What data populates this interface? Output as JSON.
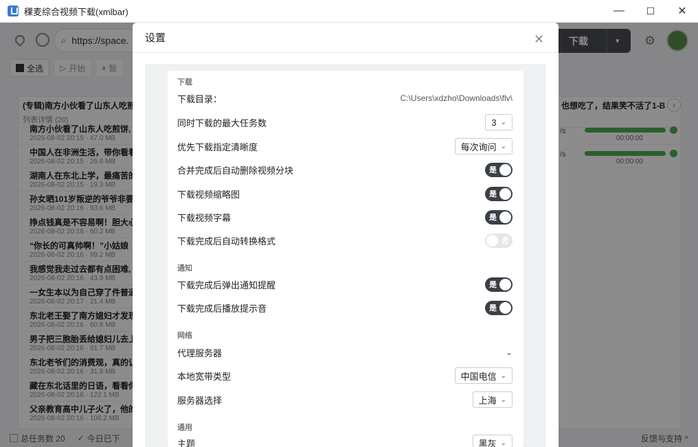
{
  "window": {
    "title": "稞麦综合视频下载(xmlbar)",
    "minimize": "—",
    "maximize": "☐",
    "close": "✕"
  },
  "toolbar": {
    "url": "https://space.",
    "download_label": "下载",
    "dropdown": "▾"
  },
  "actions": {
    "select_all": "全选",
    "start": "开始",
    "pause": "暂"
  },
  "list": {
    "group_title": "(专辑)南方小伙看了山东人吃煎",
    "group_sub": "列表详情 (20)",
    "right_title": "也想吃了，结果笑不活了1-B",
    "rows": [
      {
        "title": "南方小伙看了山东人吃煎饼,",
        "meta": "2026-08-02 20:15 · 47.0 MB"
      },
      {
        "title": "中国人在非洲生活，带你看看",
        "meta": "2026-08-02 20:15 · 26.6 MB"
      },
      {
        "title": "湖南人在东北上学，最痛苦的",
        "meta": "2026-08-02 20:15 · 19.3 MB"
      },
      {
        "title": "孙女晒101岁叛逆的爷爷非要",
        "meta": "2026-08-02 20:16 · 93.6 MB"
      },
      {
        "title": "挣点钱真是不容易啊！胆大心",
        "meta": "2026-08-02 20:16 · 60.2 MB"
      },
      {
        "title": "“你长的可真帅啊！”小姑娘",
        "meta": "2026-08-02 20:16 · 99.2 MB"
      },
      {
        "title": "我感觉我走过去都有点困难,",
        "meta": "2026-08-02 20:16 · 43.9 MB"
      },
      {
        "title": "一女生本以为自己穿了件普通",
        "meta": "2026-08-02 20:17 · 21.4 MB"
      },
      {
        "title": "东北老王娶了南方媳妇才发现",
        "meta": "2026-08-02 20:16 · 60.8 MB"
      },
      {
        "title": "男子把三胞胎丢给媳妇儿去上",
        "meta": "2026-08-02 20:16 · 91.7 MB"
      },
      {
        "title": "东北老爷们的消费观，真的让",
        "meta": "2026-08-02 20:16 · 31.8 MB"
      },
      {
        "title": "藏在东北话里的日语，看看你",
        "meta": "2026-08-02 20:16 · 122.1 MB"
      },
      {
        "title": "父亲教育高中儿子火了，他的",
        "meta": "2026-08-02 20:16 · 106.2 MB"
      }
    ],
    "progress": [
      {
        "speed": "/s",
        "time": "00:00:00",
        "percent": 100
      },
      {
        "speed": "/s",
        "time": "00:00:00",
        "percent": 100
      }
    ]
  },
  "status": {
    "total": "总任务数 20",
    "today": "今日已下",
    "support": "反馈与支持 ^"
  },
  "dialog": {
    "title": "设置",
    "close": "✕",
    "sections": {
      "download": "下载",
      "notify": "通知",
      "network": "网络",
      "general": "通用"
    },
    "download_dir": {
      "label": "下载目录：",
      "value": "C:\\Users\\xdzho\\Downloads\\flv\\"
    },
    "max_tasks": {
      "label": "同时下载的最大任务数",
      "value": "3"
    },
    "quality": {
      "label": "优先下载指定清晰度",
      "value": "每次询问"
    },
    "delete_chunks": {
      "label": "合并完成后自动删除视频分块",
      "state": "是"
    },
    "thumbnail": {
      "label": "下载视频缩略图",
      "state": "是"
    },
    "subtitle": {
      "label": "下载视频字幕",
      "state": "是"
    },
    "convert": {
      "label": "下载完成后自动转换格式",
      "state": "否"
    },
    "popup_notify": {
      "label": "下载完成后弹出通知提醒",
      "state": "是"
    },
    "sound": {
      "label": "下载完成后播放提示音",
      "state": "是"
    },
    "proxy": {
      "label": "代理服务器"
    },
    "broadband": {
      "label": "本地宽带类型",
      "value": "中国电信"
    },
    "server": {
      "label": "服务器选择",
      "value": "上海"
    },
    "theme": {
      "label": "主题",
      "value": "黑灰"
    }
  }
}
